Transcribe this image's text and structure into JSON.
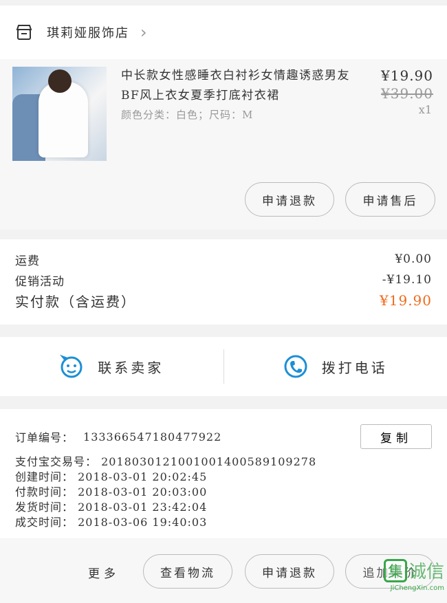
{
  "store": {
    "name": "琪莉娅服饰店"
  },
  "product": {
    "title": "中长款女性感睡衣白衬衫女情趣诱惑男友BF风上衣女夏季打底衬衣裙",
    "spec": "颜色分类：白色；尺码：M",
    "price": "¥19.90",
    "original_price": "¥39.00",
    "quantity": "x1",
    "refund_label": "申请退款",
    "aftersale_label": "申请售后"
  },
  "fees": {
    "shipping_label": "运费",
    "shipping_value": "¥0.00",
    "promo_label": "促销活动",
    "promo_value": "-¥19.10",
    "total_label": "实付款（含运费）",
    "total_value": "¥19.90",
    "accent_color": "#ee6a1c"
  },
  "contact": {
    "seller_label": "联系卖家",
    "call_label": "拨打电话",
    "icon_color": "#1c8fd6"
  },
  "order_info": {
    "order_no_label": "订单编号：",
    "order_no": "133366547180477922",
    "copy_label": "复制",
    "lines": [
      "支付宝交易号：  2018030121001001400589109278",
      "创建时间：  2018-03-01  20:02:45",
      "付款时间：  2018-03-01  20:03:00",
      "发货时间：  2018-03-01  23:42:04",
      "成交时间：  2018-03-06  19:40:03"
    ]
  },
  "bottom": {
    "more_label": "更多",
    "logistics_label": "查看物流",
    "refund_label": "申请退款",
    "review_label": "追加评价"
  },
  "watermark": {
    "logo": "集",
    "text": "诚信",
    "url": "JiChengXin.com"
  }
}
